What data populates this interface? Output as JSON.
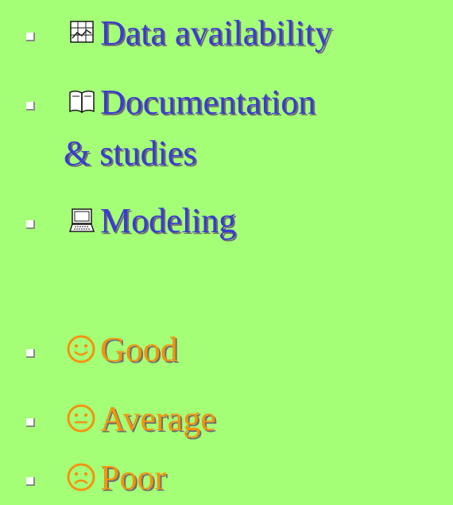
{
  "legend_top": {
    "items": [
      {
        "icon": "chart-icon",
        "label": "Data availability"
      },
      {
        "icon": "book-icon",
        "label": "Documentation",
        "label_line2": "& studies"
      },
      {
        "icon": "computer-icon",
        "label": "Modeling"
      }
    ]
  },
  "legend_bottom": {
    "items": [
      {
        "icon": "smiley-happy-icon",
        "label": "Good"
      },
      {
        "icon": "smiley-neutral-icon",
        "label": "Average"
      },
      {
        "icon": "smiley-sad-icon",
        "label": "Poor"
      }
    ]
  },
  "colors": {
    "background": "#a4ff77",
    "top_text": "#3b3bd0",
    "bottom_text": "#f5920f",
    "shadow": "#6f6f6f"
  }
}
